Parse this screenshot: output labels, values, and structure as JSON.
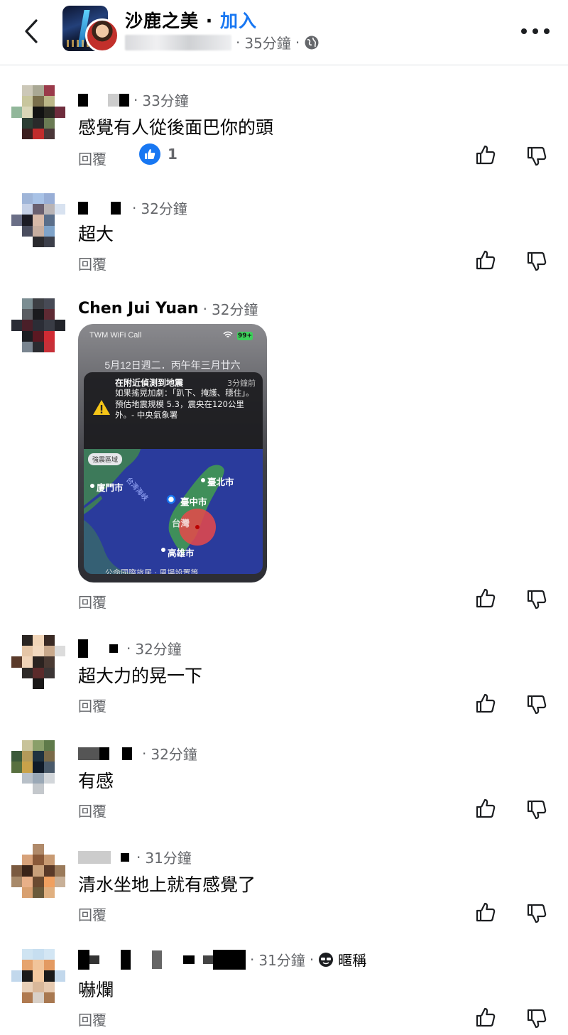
{
  "header": {
    "group_name": "沙鹿之美",
    "separator": "·",
    "join_label": "加入",
    "time": "35分鐘",
    "dot": "·"
  },
  "comments": [
    {
      "time": "33分鐘",
      "text": "感覺有人從後面巴你的頭",
      "reply": "回覆",
      "like_count": "1"
    },
    {
      "time": "32分鐘",
      "text": "超大",
      "reply": "回覆"
    },
    {
      "name": "Chen Jui Yuan",
      "time": "32分鐘",
      "reply": "回覆",
      "image": {
        "carrier": "TWM WiFi Call",
        "battery": "99+",
        "date": "5月12日週二．丙午年三月廿六",
        "alert_title": "在附近偵測到地震",
        "alert_ago": "3分鐘前",
        "alert_body": "如果搖晃加劇：「趴下、掩護、穩住」。預估地震規模 5.3，震央在120公里外。- 中央氣象署",
        "legend": "強震區域",
        "strait": "台灣海峽",
        "city_taipei": "臺北市",
        "city_xiamen": "廈門市",
        "city_taichung": "臺中市",
        "city_kaohsiung": "高雄市",
        "island_label": "台灣",
        "bottom": "公命國際旅居 · 風場設置等"
      }
    },
    {
      "time": "32分鐘",
      "text": "超大力的晃一下",
      "reply": "回覆"
    },
    {
      "time": "32分鐘",
      "text": "有感",
      "reply": "回覆"
    },
    {
      "time": "31分鐘",
      "text": "清水坐地上就有感覺了",
      "reply": "回覆"
    },
    {
      "time": "31分鐘",
      "nickname": "暱稱",
      "text": "嚇爛",
      "reply": "回覆"
    }
  ],
  "colors": {
    "accent": "#1877f2",
    "meta": "#65676b",
    "map_sea": "#2a3b9c",
    "quake": "#e8494a"
  }
}
